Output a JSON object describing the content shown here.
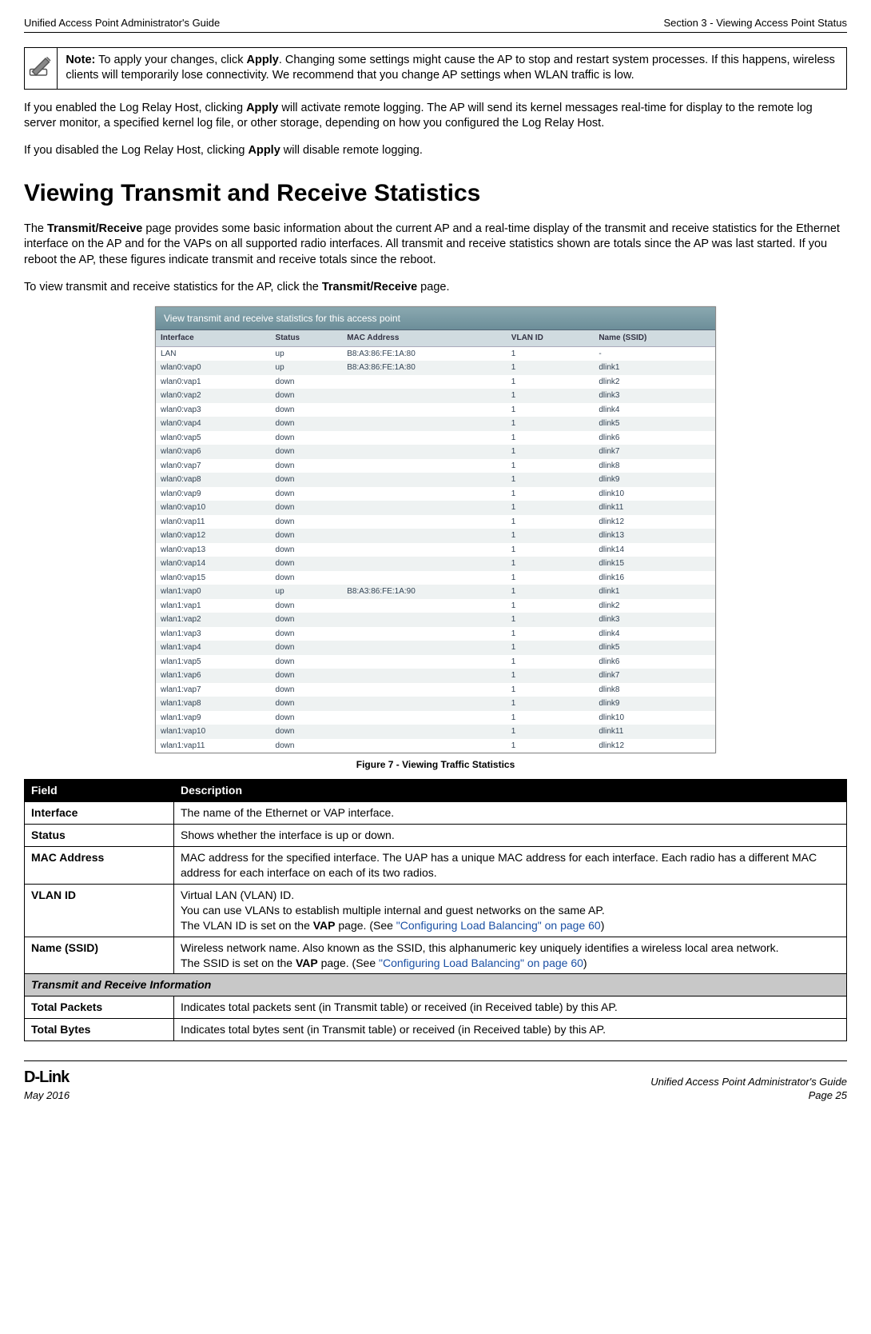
{
  "header": {
    "left": "Unified Access Point Administrator's Guide",
    "right": "Section 3 - Viewing Access Point Status"
  },
  "note": {
    "label": "Note:",
    "rest": " To apply your changes, click ",
    "apply": "Apply",
    "rest2": ". Changing some settings might cause the AP to stop and restart system processes. If this happens, wireless clients will temporarily lose connectivity. We recommend that you change AP settings when WLAN traffic is low."
  },
  "para1a": "If you enabled the Log Relay Host, clicking ",
  "para1b": "Apply",
  "para1c": " will activate remote logging. The AP will send its kernel messages real-time for display to the remote log server monitor, a specified kernel log file, or other storage, depending on how you configured the Log Relay Host.",
  "para2a": "If you disabled the Log Relay Host, clicking ",
  "para2b": "Apply",
  "para2c": " will disable remote logging.",
  "section_title": "Viewing Transmit and Receive Statistics",
  "para3a": "The ",
  "para3b": "Transmit/Receive",
  "para3c": " page provides some basic information about the current AP and a real-time display of the transmit and receive statistics for the Ethernet interface on the AP and for the VAPs on all supported radio interfaces. All transmit and receive statistics shown are totals since the AP was last started. If you reboot the AP, these figures indicate transmit and receive totals since the reboot.",
  "para4a": "To view transmit and receive statistics for the AP, click the ",
  "para4b": "Transmit/Receive",
  "para4c": " page.",
  "fig": {
    "titlebar": "View transmit and receive statistics for this access point",
    "headers": [
      "Interface",
      "Status",
      "MAC Address",
      "VLAN ID",
      "Name (SSID)"
    ],
    "rows": [
      [
        "LAN",
        "up",
        "B8:A3:86:FE:1A:80",
        "1",
        "-"
      ],
      [
        "wlan0:vap0",
        "up",
        "B8:A3:86:FE:1A:80",
        "1",
        "dlink1"
      ],
      [
        "wlan0:vap1",
        "down",
        "",
        "1",
        "dlink2"
      ],
      [
        "wlan0:vap2",
        "down",
        "",
        "1",
        "dlink3"
      ],
      [
        "wlan0:vap3",
        "down",
        "",
        "1",
        "dlink4"
      ],
      [
        "wlan0:vap4",
        "down",
        "",
        "1",
        "dlink5"
      ],
      [
        "wlan0:vap5",
        "down",
        "",
        "1",
        "dlink6"
      ],
      [
        "wlan0:vap6",
        "down",
        "",
        "1",
        "dlink7"
      ],
      [
        "wlan0:vap7",
        "down",
        "",
        "1",
        "dlink8"
      ],
      [
        "wlan0:vap8",
        "down",
        "",
        "1",
        "dlink9"
      ],
      [
        "wlan0:vap9",
        "down",
        "",
        "1",
        "dlink10"
      ],
      [
        "wlan0:vap10",
        "down",
        "",
        "1",
        "dlink11"
      ],
      [
        "wlan0:vap11",
        "down",
        "",
        "1",
        "dlink12"
      ],
      [
        "wlan0:vap12",
        "down",
        "",
        "1",
        "dlink13"
      ],
      [
        "wlan0:vap13",
        "down",
        "",
        "1",
        "dlink14"
      ],
      [
        "wlan0:vap14",
        "down",
        "",
        "1",
        "dlink15"
      ],
      [
        "wlan0:vap15",
        "down",
        "",
        "1",
        "dlink16"
      ],
      [
        "wlan1:vap0",
        "up",
        "B8:A3:86:FE:1A:90",
        "1",
        "dlink1"
      ],
      [
        "wlan1:vap1",
        "down",
        "",
        "1",
        "dlink2"
      ],
      [
        "wlan1:vap2",
        "down",
        "",
        "1",
        "dlink3"
      ],
      [
        "wlan1:vap3",
        "down",
        "",
        "1",
        "dlink4"
      ],
      [
        "wlan1:vap4",
        "down",
        "",
        "1",
        "dlink5"
      ],
      [
        "wlan1:vap5",
        "down",
        "",
        "1",
        "dlink6"
      ],
      [
        "wlan1:vap6",
        "down",
        "",
        "1",
        "dlink7"
      ],
      [
        "wlan1:vap7",
        "down",
        "",
        "1",
        "dlink8"
      ],
      [
        "wlan1:vap8",
        "down",
        "",
        "1",
        "dlink9"
      ],
      [
        "wlan1:vap9",
        "down",
        "",
        "1",
        "dlink10"
      ],
      [
        "wlan1:vap10",
        "down",
        "",
        "1",
        "dlink11"
      ],
      [
        "wlan1:vap11",
        "down",
        "",
        "1",
        "dlink12"
      ]
    ]
  },
  "figure_caption": "Figure 7 - Viewing Traffic Statistics",
  "field_table": {
    "head": [
      "Field",
      "Description"
    ],
    "rows": [
      {
        "label": "Interface",
        "desc_parts": [
          "The name of the Ethernet or VAP interface."
        ]
      },
      {
        "label": "Status",
        "desc_parts": [
          "Shows whether the interface is up or down."
        ]
      },
      {
        "label": "MAC Address",
        "desc_parts": [
          "MAC address for the specified interface. The UAP has a unique MAC address for each interface. Each radio has a different MAC address for each interface on each of its two radios."
        ]
      },
      {
        "label": "VLAN ID",
        "desc_parts": [
          "Virtual LAN (VLAN) ID.<br>You can use VLANs to establish multiple internal and guest networks on the same AP.<br>The VLAN ID is set on the <b>VAP</b> page. (See <span class='link'>\"Configuring Load Balancing\" on page 60</span>)"
        ]
      },
      {
        "label": "Name (SSID)",
        "desc_parts": [
          "Wireless network name. Also known as the SSID, this alphanumeric key uniquely identifies a wireless local area network.<br>The SSID is set on the <b>VAP</b> page. (See <span class='link'>\"Configuring Load Balancing\" on page 60</span>)"
        ]
      }
    ],
    "section_row": "Transmit and Receive Information",
    "rows2": [
      {
        "label": "Total Packets",
        "desc": "Indicates total packets sent (in Transmit table) or received (in Received table) by this AP."
      },
      {
        "label": "Total Bytes",
        "desc": "Indicates total bytes sent (in Transmit table) or received (in Received table) by this AP."
      }
    ]
  },
  "footer": {
    "logo": "D-Link",
    "date": "May 2016",
    "right1": "Unified Access Point Administrator's Guide",
    "right2": "Page 25"
  }
}
